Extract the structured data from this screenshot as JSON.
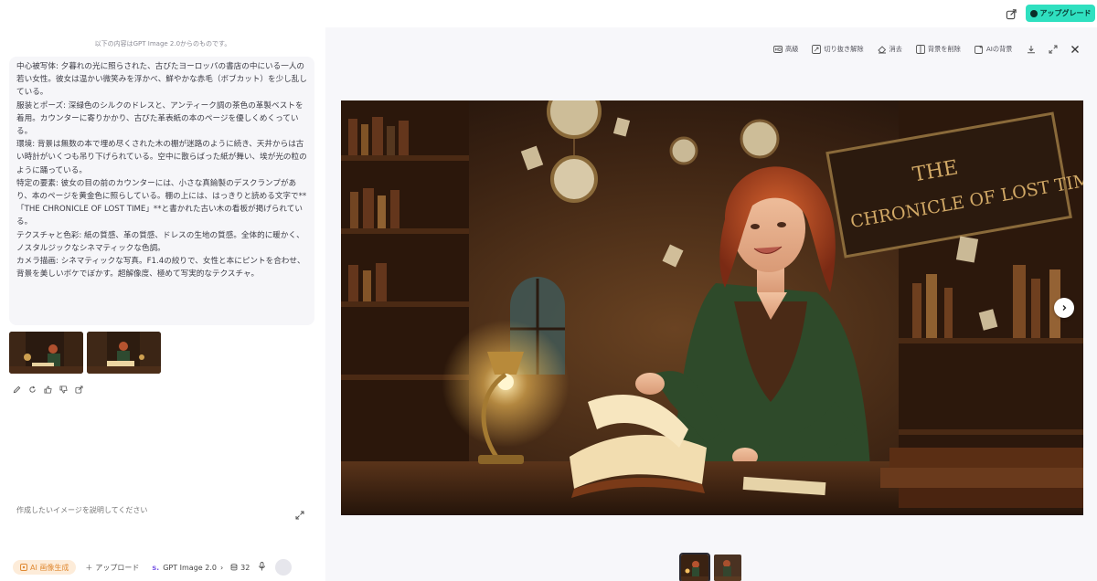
{
  "header": {
    "share_icon": "share-icon",
    "upgrade_label": "アップグレード",
    "accent": "#2fe0c0"
  },
  "chat": {
    "notice": "以下の内容はGPT Image 2.0からのものです。",
    "prompt": "中心被写体: 夕暮れの光に照らされた、古びたヨーロッパの書店の中にいる一人の若い女性。彼女は温かい微笑みを浮かべ、鮮やかな赤毛（ボブカット）を少し乱している。\n服装とポーズ: 深緑色のシルクのドレスと、アンティーク調の茶色の革製ベストを着用。カウンターに寄りかかり、古びた革表紙の本のページを優しくめくっている。\n環境: 背景は無数の本で埋め尽くされた木の棚が迷路のように続き、天井からは古い時計がいくつも吊り下げられている。空中に散らばった紙が舞い、埃が光の粒のように踊っている。\n特定の要素: 彼女の目の前のカウンターには、小さな真鍮製のデスクランプがあり、本のページを黄金色に照らしている。棚の上には、はっきりと読める文字で**「THE CHRONICLE OF LOST TIME」**と書かれた古い木の看板が掲げられている。\nテクスチャと色彩: 紙の質感、革の質感、ドレスの生地の質感。全体的に暖かく、ノスタルジックなシネマティックな色調。\nカメラ描画: シネマティックな写真。F1.4の絞りで、女性と本にピントを合わせ、背景を美しいボケでぼかす。超解像度、極めて写実的なテクスチャ。"
  },
  "composer": {
    "placeholder": "作成したいイメージを説明してください",
    "ai_label": "AI 画像生成",
    "upload_label": "アップロード",
    "model_label": "GPT Image 2.0",
    "credits": "32"
  },
  "toolbar": {
    "items": [
      "高級",
      "切り抜き解除",
      "消去",
      "背景を削除",
      "AIの背景"
    ]
  },
  "artwork": {
    "sign_line1": "THE",
    "sign_line2": "CHRONICLE OF LOST TIME"
  }
}
